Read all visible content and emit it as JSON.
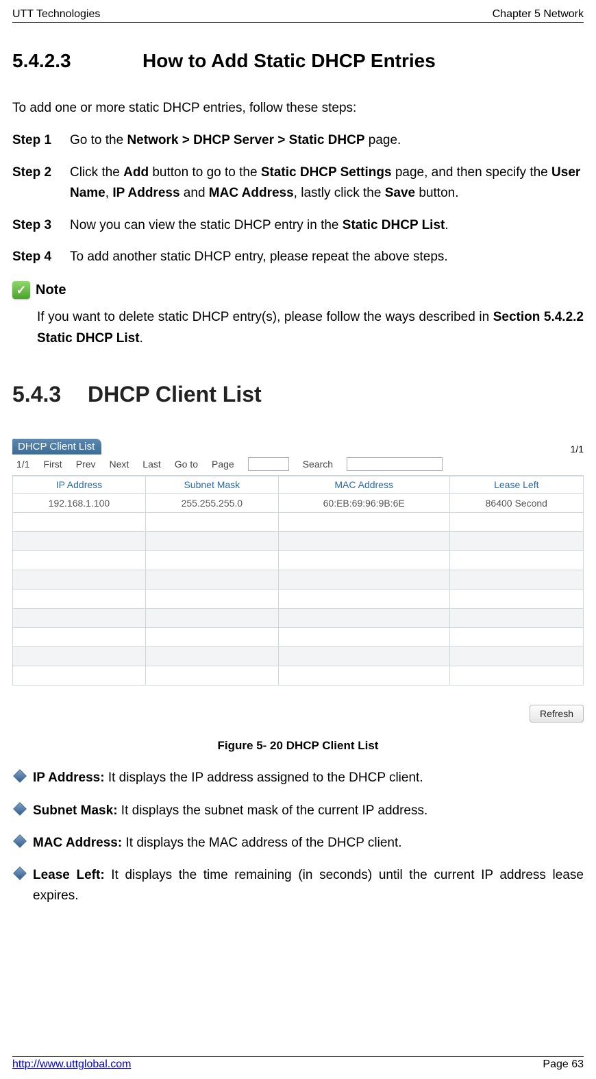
{
  "header": {
    "left": "UTT Technologies",
    "right": "Chapter 5 Network"
  },
  "section": {
    "number": "5.4.2.3",
    "title": "How to Add Static DHCP Entries",
    "intro": "To add one or more static DHCP entries, follow these steps:",
    "steps": [
      {
        "label": "Step 1",
        "parts": [
          "Go to the ",
          "Network > DHCP Server > Static DHCP",
          " page."
        ]
      },
      {
        "label": "Step 2",
        "parts": [
          "Click the ",
          "Add",
          " button to go to the ",
          "Static DHCP Settings",
          " page, and then specify the ",
          "User Name",
          ", ",
          "IP Address",
          " and ",
          "MAC Address",
          ", lastly click the ",
          "Save",
          " button."
        ]
      },
      {
        "label": "Step 3",
        "parts": [
          "Now you can view the static DHCP entry in the ",
          "Static DHCP List",
          "."
        ]
      },
      {
        "label": "Step 4",
        "parts": [
          "To add another static DHCP entry, please repeat the above steps."
        ]
      }
    ],
    "note_label": "Note",
    "note_parts": [
      "If you want to delete static DHCP entry(s), please follow the ways described in ",
      "Section 5.4.2.2 Static DHCP List",
      "."
    ]
  },
  "section2": {
    "number": "5.4.3",
    "title": "DHCP Client List"
  },
  "panel": {
    "title": "DHCP Client List",
    "page_right": "1/1",
    "pager": {
      "pos": "1/1",
      "first": "First",
      "prev": "Prev",
      "next": "Next",
      "last": "Last",
      "goto": "Go to",
      "page": "Page",
      "search": "Search"
    },
    "headers": [
      "IP Address",
      "Subnet Mask",
      "MAC Address",
      "Lease Left"
    ],
    "rows": [
      [
        "192.168.1.100",
        "255.255.255.0",
        "60:EB:69:96:9B:6E",
        "86400 Second"
      ],
      [
        "",
        "",
        "",
        ""
      ],
      [
        "",
        "",
        "",
        ""
      ],
      [
        "",
        "",
        "",
        ""
      ],
      [
        "",
        "",
        "",
        ""
      ],
      [
        "",
        "",
        "",
        ""
      ],
      [
        "",
        "",
        "",
        ""
      ],
      [
        "",
        "",
        "",
        ""
      ],
      [
        "",
        "",
        "",
        ""
      ],
      [
        "",
        "",
        "",
        ""
      ]
    ],
    "refresh": "Refresh"
  },
  "figure_caption": "Figure 5- 20 DHCP Client List",
  "bullets": [
    {
      "label": "IP Address:",
      "text": " It displays the IP address assigned to the DHCP client."
    },
    {
      "label": "Subnet Mask:",
      "text": " It displays the subnet mask of the current IP address."
    },
    {
      "label": "MAC Address:",
      "text": " It displays the MAC address of the DHCP client."
    },
    {
      "label": "Lease Left:",
      "text": " It displays the time remaining (in seconds) until the current IP address lease expires."
    }
  ],
  "footer": {
    "url": "http://www.uttglobal.com",
    "page": "Page 63"
  }
}
